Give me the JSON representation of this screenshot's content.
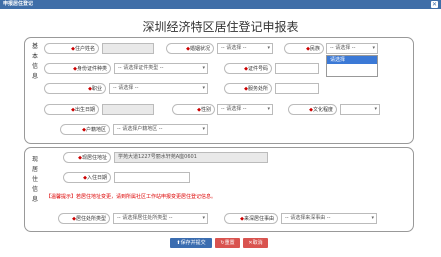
{
  "window": {
    "title": "申报居住登记",
    "close_glyph": "✕"
  },
  "form": {
    "title": "深圳经济特区居住登记申报表"
  },
  "basic": {
    "section_label": "基本信息",
    "name_label": "住户姓名",
    "marital_label": "婚姻状况",
    "marital_value": "-- 请选择 --",
    "nationality_label": "民族",
    "nationality_value": "-- 请选择 --",
    "nationality_option": "请选择",
    "id_type_label": "身份证件种类",
    "id_type_value": "-- 请选择证件类型 --",
    "id_number_label": "证件号码",
    "job_label": "职业",
    "job_value": "-- 请选择 --",
    "service_label": "服务处所",
    "birth_label": "出生日期",
    "gender_label": "性别",
    "gender_value": "-- 请选择 --",
    "education_label": "文化程度",
    "origin_label": "户籍地区",
    "origin_value": "-- 请选择户籍地区 --"
  },
  "residence": {
    "section_label": "现居住信息",
    "address_label": "现居住地址",
    "address_value": "学苑大道1227号丽水轩苑A座0601",
    "date_label": "入住日期",
    "warning": "【温馨提示】若居住地址变更，请到所属社区工作站申报变更居住登记信息。",
    "res_type_label": "居住处所类型",
    "res_type_value": "-- 请选择居住处所类型 --",
    "reason_label": "来深居住事由",
    "reason_value": "-- 请选择来深事由 --"
  },
  "buttons": {
    "save": "保存并提交",
    "reset": "重置",
    "cancel": "取消"
  },
  "colors": {
    "titlebar": "#3f6ea8",
    "save_btn": "#3b6db0",
    "reset_btn": "#d9534f",
    "cancel_btn": "#d9534f",
    "warning": "#dd0000",
    "highlight": "#3b79d6"
  }
}
